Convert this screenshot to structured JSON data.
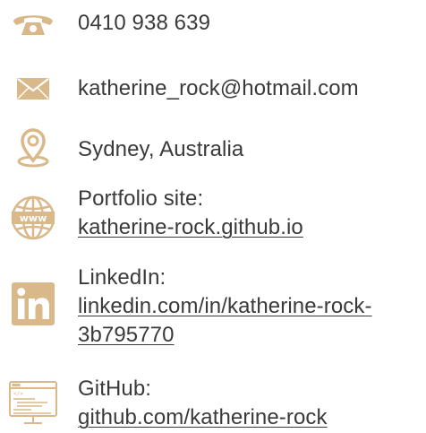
{
  "accent_color": "#d9b88a",
  "contacts": {
    "phone": {
      "icon": "phone-icon",
      "value": "0410 938 639"
    },
    "email": {
      "icon": "envelope-icon",
      "value": "katherine_rock@hotmail.com"
    },
    "location": {
      "icon": "location-pin-icon",
      "value": "Sydney, Australia"
    },
    "portfolio": {
      "icon": "globe-www-icon",
      "label": "Portfolio site:",
      "link": "katherine-rock.github.io"
    },
    "linkedin": {
      "icon": "linkedin-icon",
      "label": "LinkedIn:",
      "link_line1": "linkedin.com/in/katherine-rock-",
      "link_line2": "3b795770"
    },
    "github": {
      "icon": "code-monitor-icon",
      "label": "GitHub:",
      "link": "github.com/katherine-rock"
    }
  }
}
